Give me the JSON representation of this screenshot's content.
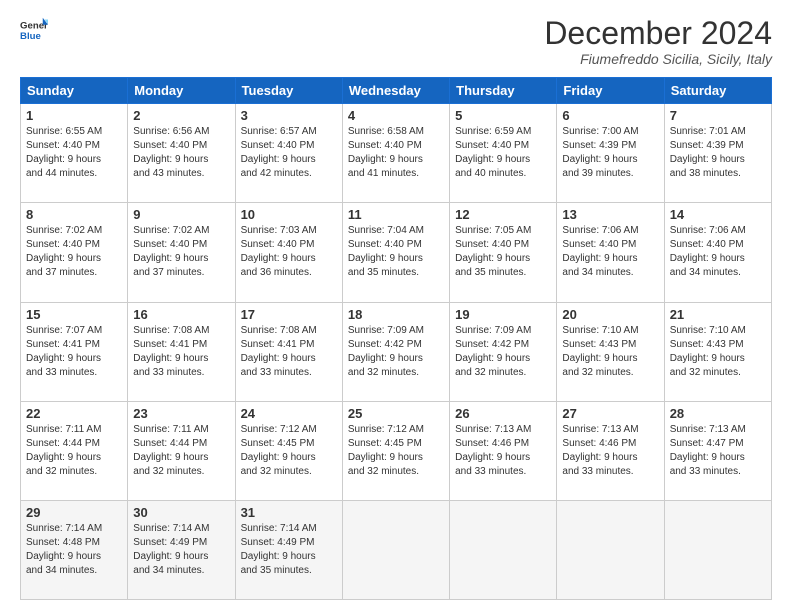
{
  "header": {
    "logo_line1": "General",
    "logo_line2": "Blue",
    "month_title": "December 2024",
    "location": "Fiumefreddo Sicilia, Sicily, Italy"
  },
  "weekdays": [
    "Sunday",
    "Monday",
    "Tuesday",
    "Wednesday",
    "Thursday",
    "Friday",
    "Saturday"
  ],
  "weeks": [
    [
      {
        "day": "1",
        "info": "Sunrise: 6:55 AM\nSunset: 4:40 PM\nDaylight: 9 hours\nand 44 minutes."
      },
      {
        "day": "2",
        "info": "Sunrise: 6:56 AM\nSunset: 4:40 PM\nDaylight: 9 hours\nand 43 minutes."
      },
      {
        "day": "3",
        "info": "Sunrise: 6:57 AM\nSunset: 4:40 PM\nDaylight: 9 hours\nand 42 minutes."
      },
      {
        "day": "4",
        "info": "Sunrise: 6:58 AM\nSunset: 4:40 PM\nDaylight: 9 hours\nand 41 minutes."
      },
      {
        "day": "5",
        "info": "Sunrise: 6:59 AM\nSunset: 4:40 PM\nDaylight: 9 hours\nand 40 minutes."
      },
      {
        "day": "6",
        "info": "Sunrise: 7:00 AM\nSunset: 4:39 PM\nDaylight: 9 hours\nand 39 minutes."
      },
      {
        "day": "7",
        "info": "Sunrise: 7:01 AM\nSunset: 4:39 PM\nDaylight: 9 hours\nand 38 minutes."
      }
    ],
    [
      {
        "day": "8",
        "info": "Sunrise: 7:02 AM\nSunset: 4:40 PM\nDaylight: 9 hours\nand 37 minutes."
      },
      {
        "day": "9",
        "info": "Sunrise: 7:02 AM\nSunset: 4:40 PM\nDaylight: 9 hours\nand 37 minutes."
      },
      {
        "day": "10",
        "info": "Sunrise: 7:03 AM\nSunset: 4:40 PM\nDaylight: 9 hours\nand 36 minutes."
      },
      {
        "day": "11",
        "info": "Sunrise: 7:04 AM\nSunset: 4:40 PM\nDaylight: 9 hours\nand 35 minutes."
      },
      {
        "day": "12",
        "info": "Sunrise: 7:05 AM\nSunset: 4:40 PM\nDaylight: 9 hours\nand 35 minutes."
      },
      {
        "day": "13",
        "info": "Sunrise: 7:06 AM\nSunset: 4:40 PM\nDaylight: 9 hours\nand 34 minutes."
      },
      {
        "day": "14",
        "info": "Sunrise: 7:06 AM\nSunset: 4:40 PM\nDaylight: 9 hours\nand 34 minutes."
      }
    ],
    [
      {
        "day": "15",
        "info": "Sunrise: 7:07 AM\nSunset: 4:41 PM\nDaylight: 9 hours\nand 33 minutes."
      },
      {
        "day": "16",
        "info": "Sunrise: 7:08 AM\nSunset: 4:41 PM\nDaylight: 9 hours\nand 33 minutes."
      },
      {
        "day": "17",
        "info": "Sunrise: 7:08 AM\nSunset: 4:41 PM\nDaylight: 9 hours\nand 33 minutes."
      },
      {
        "day": "18",
        "info": "Sunrise: 7:09 AM\nSunset: 4:42 PM\nDaylight: 9 hours\nand 32 minutes."
      },
      {
        "day": "19",
        "info": "Sunrise: 7:09 AM\nSunset: 4:42 PM\nDaylight: 9 hours\nand 32 minutes."
      },
      {
        "day": "20",
        "info": "Sunrise: 7:10 AM\nSunset: 4:43 PM\nDaylight: 9 hours\nand 32 minutes."
      },
      {
        "day": "21",
        "info": "Sunrise: 7:10 AM\nSunset: 4:43 PM\nDaylight: 9 hours\nand 32 minutes."
      }
    ],
    [
      {
        "day": "22",
        "info": "Sunrise: 7:11 AM\nSunset: 4:44 PM\nDaylight: 9 hours\nand 32 minutes."
      },
      {
        "day": "23",
        "info": "Sunrise: 7:11 AM\nSunset: 4:44 PM\nDaylight: 9 hours\nand 32 minutes."
      },
      {
        "day": "24",
        "info": "Sunrise: 7:12 AM\nSunset: 4:45 PM\nDaylight: 9 hours\nand 32 minutes."
      },
      {
        "day": "25",
        "info": "Sunrise: 7:12 AM\nSunset: 4:45 PM\nDaylight: 9 hours\nand 32 minutes."
      },
      {
        "day": "26",
        "info": "Sunrise: 7:13 AM\nSunset: 4:46 PM\nDaylight: 9 hours\nand 33 minutes."
      },
      {
        "day": "27",
        "info": "Sunrise: 7:13 AM\nSunset: 4:46 PM\nDaylight: 9 hours\nand 33 minutes."
      },
      {
        "day": "28",
        "info": "Sunrise: 7:13 AM\nSunset: 4:47 PM\nDaylight: 9 hours\nand 33 minutes."
      }
    ],
    [
      {
        "day": "29",
        "info": "Sunrise: 7:14 AM\nSunset: 4:48 PM\nDaylight: 9 hours\nand 34 minutes."
      },
      {
        "day": "30",
        "info": "Sunrise: 7:14 AM\nSunset: 4:49 PM\nDaylight: 9 hours\nand 34 minutes."
      },
      {
        "day": "31",
        "info": "Sunrise: 7:14 AM\nSunset: 4:49 PM\nDaylight: 9 hours\nand 35 minutes."
      },
      {
        "day": "",
        "info": ""
      },
      {
        "day": "",
        "info": ""
      },
      {
        "day": "",
        "info": ""
      },
      {
        "day": "",
        "info": ""
      }
    ]
  ]
}
